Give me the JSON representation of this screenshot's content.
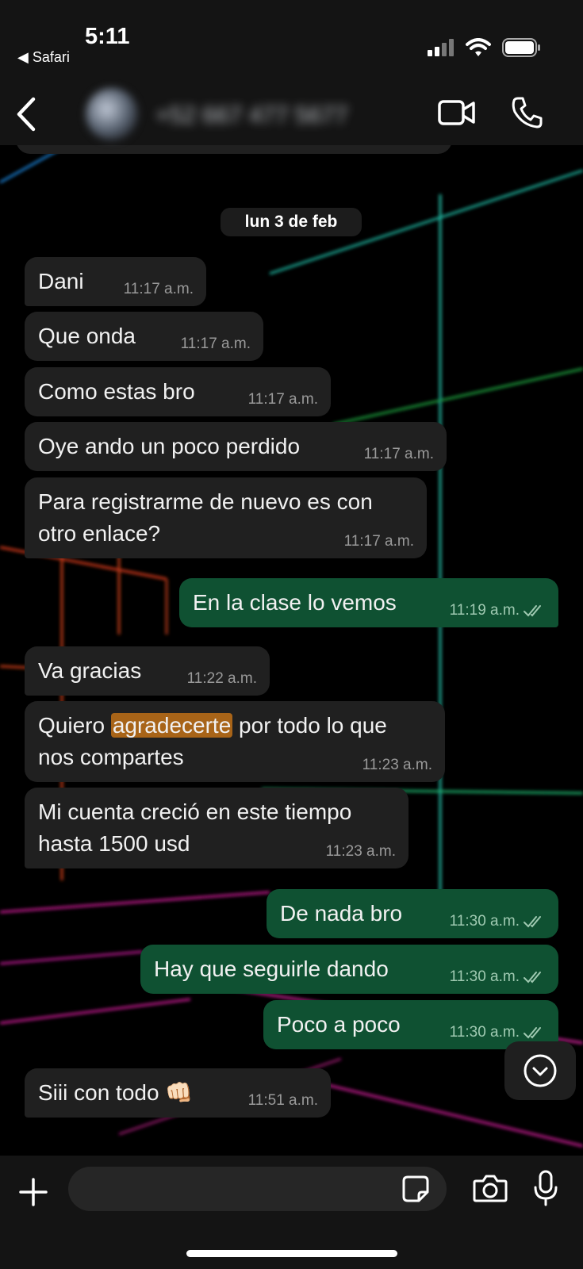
{
  "status_bar": {
    "time": "5:11",
    "back_app": "Safari"
  },
  "header": {
    "contact_name": "+52 667 477 5677"
  },
  "date_separator": "lun 3 de feb",
  "messages": [
    {
      "dir": "in",
      "text": "Dani",
      "time": "11:17 a.m."
    },
    {
      "dir": "in",
      "text": "Que onda",
      "time": "11:17 a.m."
    },
    {
      "dir": "in",
      "text": "Como estas bro",
      "time": "11:17 a.m."
    },
    {
      "dir": "in",
      "text": "Oye ando un poco perdido",
      "time": "11:17 a.m."
    },
    {
      "dir": "in",
      "text_line1": "Para registrarme de nuevo es con",
      "text_line2": "otro enlace?",
      "time": "11:17 a.m."
    },
    {
      "dir": "out",
      "text": "En la clase lo vemos",
      "time": "11:19 a.m.",
      "status": "read"
    },
    {
      "dir": "in",
      "text": "Va gracias",
      "time": "11:22 a.m."
    },
    {
      "dir": "in",
      "text_before": "Quiero ",
      "highlight": "agradecerte",
      "text_after": " por todo lo que",
      "text_line2": "nos compartes",
      "time": "11:23 a.m."
    },
    {
      "dir": "in",
      "text_line1": "Mi cuenta creció en este tiempo",
      "text_line2": "hasta 1500 usd",
      "time": "11:23 a.m."
    },
    {
      "dir": "out",
      "text": "De nada bro",
      "time": "11:30 a.m.",
      "status": "read"
    },
    {
      "dir": "out",
      "text": "Hay que seguirle dando",
      "time": "11:30 a.m.",
      "status": "read"
    },
    {
      "dir": "out",
      "text": "Poco a poco",
      "time": "11:30 a.m.",
      "status": "read"
    },
    {
      "dir": "in",
      "text": "Siii con todo",
      "emoji": "👊🏻",
      "time": "11:51 a.m."
    }
  ],
  "composer": {
    "placeholder": ""
  },
  "colors": {
    "incoming_bubble": "#202020",
    "outgoing_bubble": "#0f5132",
    "highlight": "#a86418",
    "bars": "#141414"
  }
}
